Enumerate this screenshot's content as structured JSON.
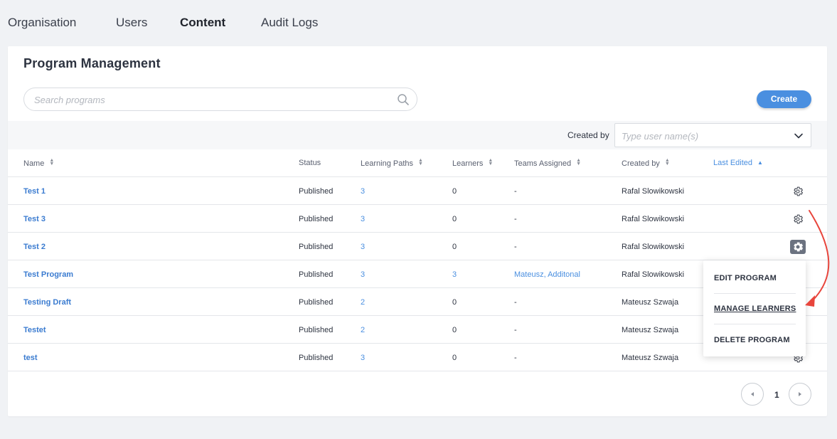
{
  "nav": {
    "tabs": [
      {
        "label": "Organisation",
        "active": false
      },
      {
        "label": "Users",
        "active": false
      },
      {
        "label": "Content",
        "active": true
      },
      {
        "label": "Audit Logs",
        "active": false
      }
    ]
  },
  "page": {
    "title": "Program Management",
    "search_placeholder": "Search programs",
    "create_label": "Create",
    "filter_label": "Created by",
    "filter_placeholder": "Type user name(s)"
  },
  "table": {
    "columns": {
      "name": "Name",
      "status": "Status",
      "paths": "Learning Paths",
      "learners": "Learners",
      "teams": "Teams Assigned",
      "creator": "Created by",
      "edited": "Last Edited"
    },
    "rows": [
      {
        "name": "Test 1",
        "status": "Published",
        "paths": "3",
        "learners": "0",
        "teams": "-",
        "creator": "Rafal Slowikowski"
      },
      {
        "name": "Test 3",
        "status": "Published",
        "paths": "3",
        "learners": "0",
        "teams": "-",
        "creator": "Rafal Slowikowski"
      },
      {
        "name": "Test 2",
        "status": "Published",
        "paths": "3",
        "learners": "0",
        "teams": "-",
        "creator": "Rafal Slowikowski"
      },
      {
        "name": "Test Program",
        "status": "Published",
        "paths": "3",
        "learners": "3",
        "teams": "Mateusz, Additonal",
        "creator": "Rafal Slowikowski"
      },
      {
        "name": "Testing Draft",
        "status": "Published",
        "paths": "2",
        "learners": "0",
        "teams": "-",
        "creator": "Mateusz Szwaja"
      },
      {
        "name": "Testet",
        "status": "Published",
        "paths": "2",
        "learners": "0",
        "teams": "-",
        "creator": "Mateusz Szwaja"
      },
      {
        "name": "test",
        "status": "Published",
        "paths": "3",
        "learners": "0",
        "teams": "-",
        "creator": "Mateusz Szwaja"
      }
    ]
  },
  "menu": {
    "edit": "EDIT PROGRAM",
    "manage": "MANAGE LEARNERS",
    "delete": "DELETE PROGRAM"
  },
  "pagination": {
    "current_page": "1"
  },
  "colors": {
    "accent": "#4a8fe0",
    "annotation_arrow": "#e8453c"
  },
  "icons": {
    "search": "search-icon",
    "chevron": "chevron-down-icon",
    "gear": "gear-icon",
    "prev": "caret-left-icon",
    "next": "caret-right-icon"
  }
}
